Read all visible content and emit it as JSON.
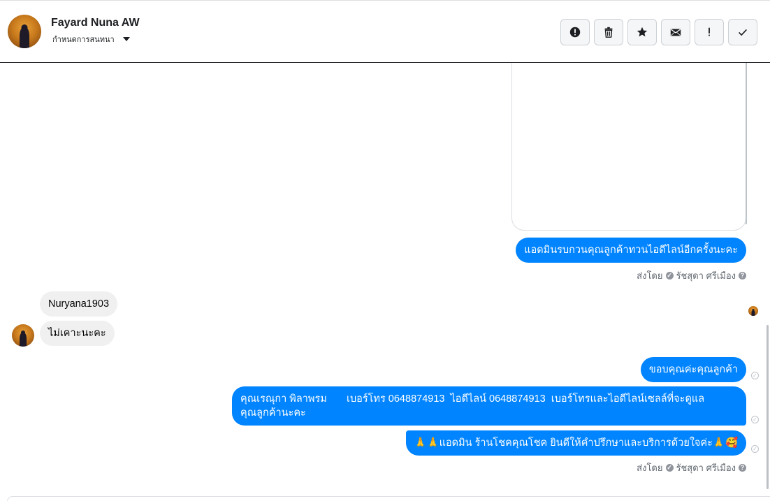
{
  "header": {
    "contact_name": "Fayard Nuna AW",
    "conversation_status": "กำหนดการสนทนา",
    "actions": [
      {
        "icon": "alert-circle-icon"
      },
      {
        "icon": "trash-icon"
      },
      {
        "icon": "star-icon"
      },
      {
        "icon": "envelope-icon"
      },
      {
        "icon": "exclamation-icon"
      },
      {
        "icon": "checkmark-icon"
      }
    ]
  },
  "messages": {
    "m1": "แอดมินรบกวนคุณลูกค้าทวนไอดีไลน์อีกครั้งนะคะ",
    "sent_by_1": {
      "prefix": "ส่งโดย",
      "agent": "รัชสุดา ศรีเมือง"
    },
    "in1": "Nuryana1903",
    "in2": "ไม่เคาะนะคะ",
    "m2": "ขอบคุณค่ะคุณลูกค้า",
    "m3_line1": "คุณเรณุกา พิลาพรม       เบอร์โทร 0648874913  ไอดีไลน์ 0648874913  เบอร์โทรและไอดีไลน์เซลล์ที่จะดูแล",
    "m3_line2": "คุณลูกค้านะคะ",
    "m4": "🙏🙏แอดมิน ร้านโชคคุณโชค ยินดีให้คำปรึกษาและบริการด้วยใจค่ะ🙏🥰",
    "sent_by_2": {
      "prefix": "ส่งโดย",
      "agent": "รัชสุดา ศรีเมือง"
    }
  },
  "colors": {
    "outgoing_bubble": "#0084ff",
    "incoming_bubble": "#f0f0f0"
  }
}
